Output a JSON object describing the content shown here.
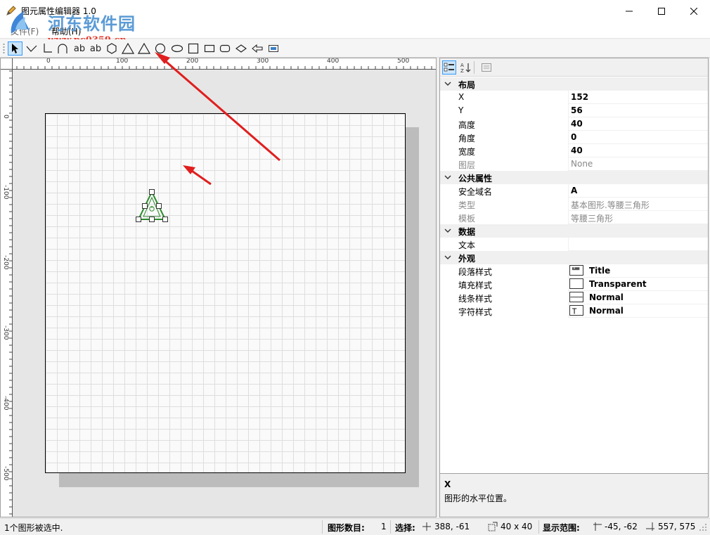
{
  "window": {
    "title": "图元属性编辑器 1.0",
    "icon": "pencil-app-icon"
  },
  "watermark": {
    "name": "河东软件园",
    "url": "www.pc0359.cn"
  },
  "menu": {
    "file": "文件(F)",
    "help": "帮助(H)"
  },
  "toolbar": {
    "tools": [
      {
        "name": "pointer-tool",
        "icon": "arrow-pointer-icon"
      },
      {
        "name": "polyline-tool",
        "icon": "polyline-icon"
      },
      {
        "name": "connector-tool",
        "icon": "elbow-connector-icon"
      },
      {
        "name": "arc-tool",
        "icon": "arc-icon"
      },
      {
        "name": "text-tool-1",
        "label": "ab"
      },
      {
        "name": "text-tool-2",
        "label": "ab"
      },
      {
        "name": "hexagon-tool",
        "icon": "hexagon-icon"
      },
      {
        "name": "triangle-tool",
        "icon": "triangle-icon"
      },
      {
        "name": "isosceles-triangle-tool",
        "icon": "isosceles-triangle-icon"
      },
      {
        "name": "circle-tool",
        "icon": "circle-icon"
      },
      {
        "name": "ellipse-tool",
        "icon": "ellipse-icon"
      },
      {
        "name": "square-tool",
        "icon": "square-icon"
      },
      {
        "name": "rectangle-tool",
        "icon": "rectangle-icon"
      },
      {
        "name": "rounded-rect-tool",
        "icon": "rounded-rectangle-icon"
      },
      {
        "name": "diamond-tool",
        "icon": "diamond-icon"
      },
      {
        "name": "arrow-shape-tool",
        "icon": "left-arrow-icon"
      },
      {
        "name": "image-tool",
        "icon": "image-icon"
      }
    ]
  },
  "ruler": {
    "h_labels": [
      "0",
      "100",
      "200",
      "300",
      "400",
      "500"
    ],
    "v_labels": [
      "0",
      "-100",
      "-200",
      "-300",
      "-400",
      "-500"
    ]
  },
  "properties": {
    "categories": [
      {
        "label": "布局",
        "rows": [
          {
            "name": "X",
            "value": "152",
            "dim": false
          },
          {
            "name": "Y",
            "value": "56",
            "dim": false
          },
          {
            "name": "高度",
            "value": "40",
            "dim": false
          },
          {
            "name": "角度",
            "value": "0",
            "dim": false
          },
          {
            "name": "宽度",
            "value": "40",
            "dim": false
          },
          {
            "name": "图层",
            "value": "None",
            "dim": true
          }
        ]
      },
      {
        "label": "公共属性",
        "rows": [
          {
            "name": "安全域名",
            "value": "A",
            "dim": false
          },
          {
            "name": "类型",
            "value": "基本图形.等腰三角形",
            "dim": true
          },
          {
            "name": "模板",
            "value": "等腰三角形",
            "dim": true
          }
        ]
      },
      {
        "label": "数据",
        "rows": [
          {
            "name": "文本",
            "value": "",
            "dim": false
          }
        ]
      },
      {
        "label": "外观",
        "rows": [
          {
            "name": "段落样式",
            "value": "Title",
            "swatch": "paragraph-style-icon"
          },
          {
            "name": "填充样式",
            "value": "Transparent",
            "swatch": "fill-style-icon"
          },
          {
            "name": "线条样式",
            "value": "Normal",
            "swatch": "line-style-icon"
          },
          {
            "name": "字符样式",
            "value": "Normal",
            "swatch": "char-style-icon"
          }
        ]
      }
    ],
    "description": {
      "title": "X",
      "text": "图形的水平位置。"
    }
  },
  "status": {
    "selection_msg": "1个图形被选中.",
    "count_label": "图形数目:",
    "count_value": "1",
    "select_label": "选择:",
    "select_pos": "388, -61",
    "select_size": "40 x 40",
    "view_label": "显示范围:",
    "view_min": "-45, -62",
    "view_max": "557, 575"
  },
  "colors": {
    "accent": "#3399ff",
    "shape_stroke": "#2e8b2e",
    "annotation_arrow": "#e01e1e"
  }
}
